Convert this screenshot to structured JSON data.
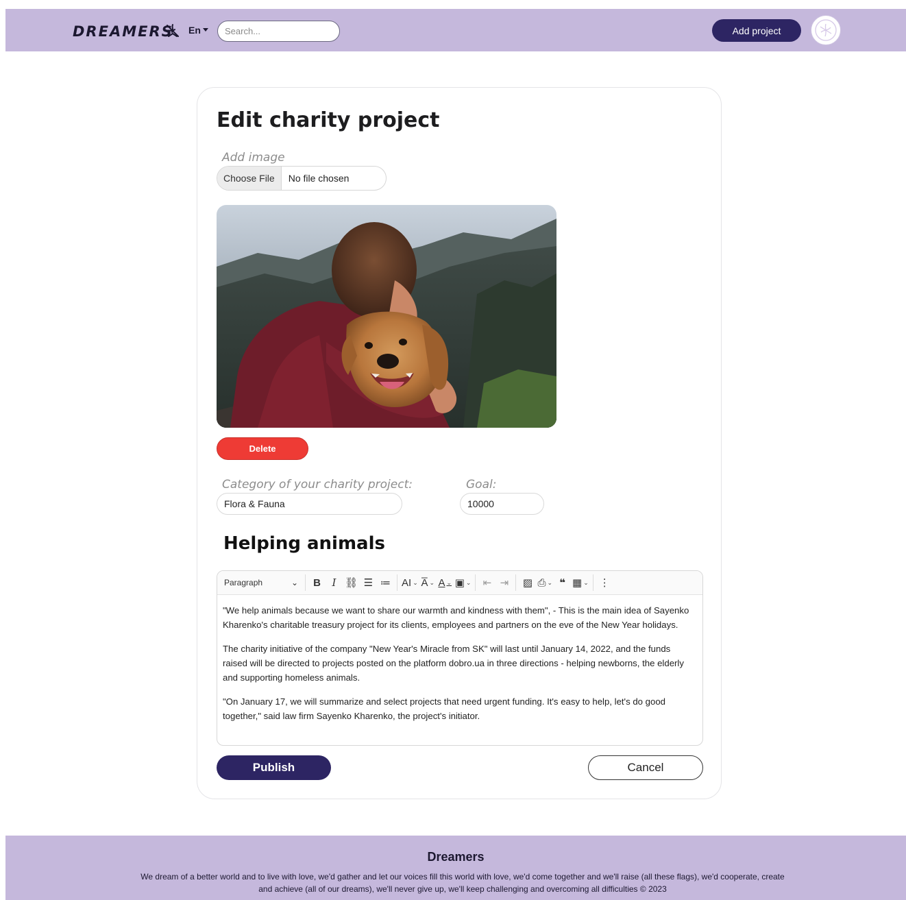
{
  "header": {
    "logo": "DREAMERS",
    "language": "En",
    "search_placeholder": "Search...",
    "add_project": "Add project"
  },
  "form": {
    "title": "Edit charity project",
    "add_image_label": "Add image",
    "file_button": "Choose File",
    "file_status": "No file chosen",
    "delete_label": "Delete",
    "category_label": "Category of your charity project:",
    "category_value": "Flora & Fauna",
    "goal_label": "Goal:",
    "goal_value": "10000",
    "project_title": "Helping animals",
    "editor": {
      "paragraph_style": "Paragraph",
      "paragraphs": [
        "\"We help animals because we want to share our warmth and kindness with them\", - This is the main idea of Sayenko Kharenko's charitable treasury project for its clients, employees and partners on the eve of the New Year holidays.",
        "The charity initiative of the company \"New Year's Miracle from SK\" will last until January 14, 2022, and the funds raised will be directed to projects posted on the platform dobro.ua in three directions - helping newborns, the elderly and supporting homeless animals.",
        "\"On January 17, we will summarize and select projects that need urgent funding. It's easy to help, let's do good together,\" said law firm Sayenko Kharenko, the project's initiator."
      ]
    },
    "publish_label": "Publish",
    "cancel_label": "Cancel"
  },
  "footer": {
    "title": "Dreamers",
    "text": "We dream of a better world and to live with love, we'd gather and let our voices fill this world with love, we'd come together and we'll raise (all these flags), we'd cooperate, create and achieve (all of our dreams), we'll never give up, we'll keep challenging and overcoming all difficulties © 2023"
  },
  "colors": {
    "header_bg": "#c5b8dc",
    "primary": "#2d2563",
    "danger": "#ee3b35"
  }
}
